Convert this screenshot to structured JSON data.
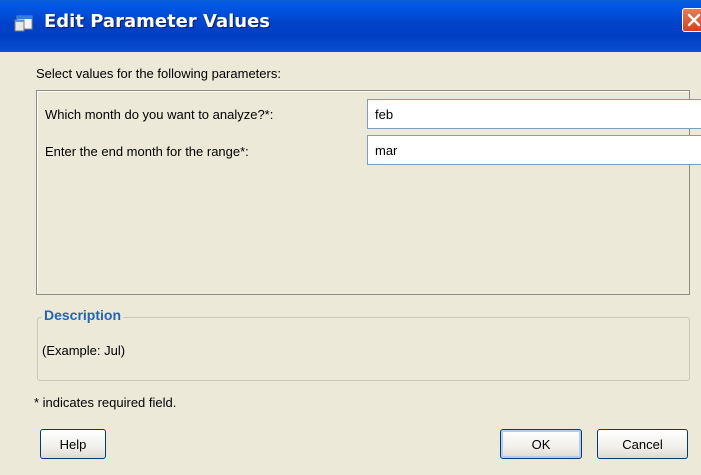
{
  "window": {
    "title": "Edit Parameter Values",
    "title_icon": "app-window-icon",
    "close_icon": "close-icon"
  },
  "instruction": "Select values for the following parameters:",
  "parameters": [
    {
      "label": "Which month do you want to analyze?*:",
      "value": "feb"
    },
    {
      "label": "Enter the end month for the range*:",
      "value": "mar"
    }
  ],
  "description": {
    "legend": "Description",
    "text": "(Example: Jul)"
  },
  "required_note": "* indicates required field.",
  "buttons": {
    "help": "Help",
    "ok": "OK",
    "cancel": "Cancel"
  }
}
